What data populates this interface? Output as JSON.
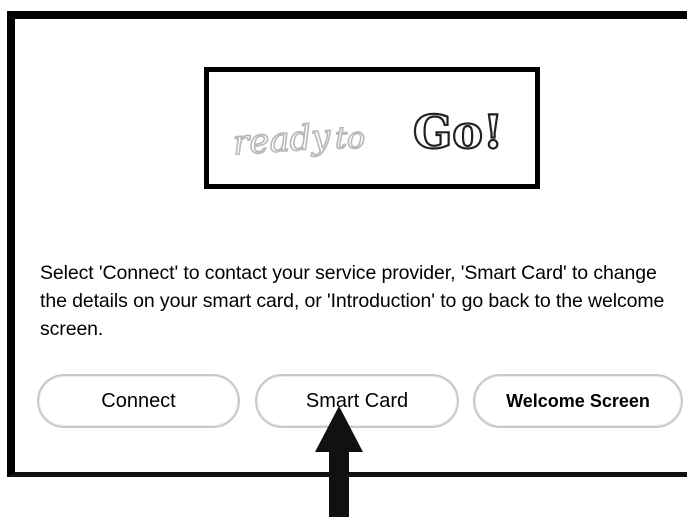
{
  "logo": {
    "word1": "ready",
    "word2": "to",
    "word3": "Go!"
  },
  "instructions": "Select 'Connect' to contact your service provider, 'Smart Card' to change the details on your smart card, or 'Introduction' to go back to the welcome screen.",
  "buttons": {
    "connect": "Connect",
    "smart_card": "Smart Card",
    "welcome_screen": "Welcome Screen"
  },
  "colors": {
    "frame": "#000000",
    "button_border": "#c9c9c9",
    "logo_light_text": "#bdbdbd"
  },
  "annotation": {
    "arrow_target": "Smart Card"
  }
}
